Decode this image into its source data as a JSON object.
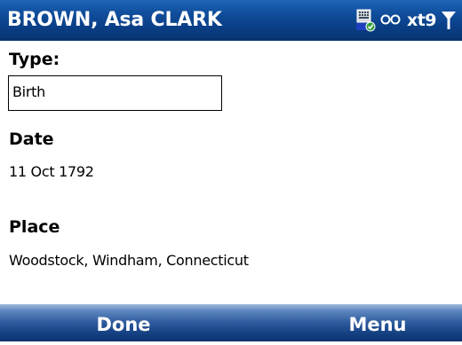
{
  "title_bar": {
    "title": "BROWN, Asa CLARK",
    "input_mode": "xt9",
    "icons": [
      "keyboard-icon",
      "multipress-icon",
      "signal-icon"
    ]
  },
  "fields": {
    "type": {
      "label": "Type:",
      "value": "Birth"
    },
    "date": {
      "label": "Date",
      "value": "11 Oct 1792"
    },
    "place": {
      "label": "Place",
      "value": "Woodstock, Windham, Connecticut"
    }
  },
  "softkeys": {
    "left": "Done",
    "right": "Menu"
  },
  "colors": {
    "title_bar": "#0f4a98",
    "softkey_bar": "#2c5a9c",
    "text": "#000000",
    "background": "#ffffff"
  }
}
